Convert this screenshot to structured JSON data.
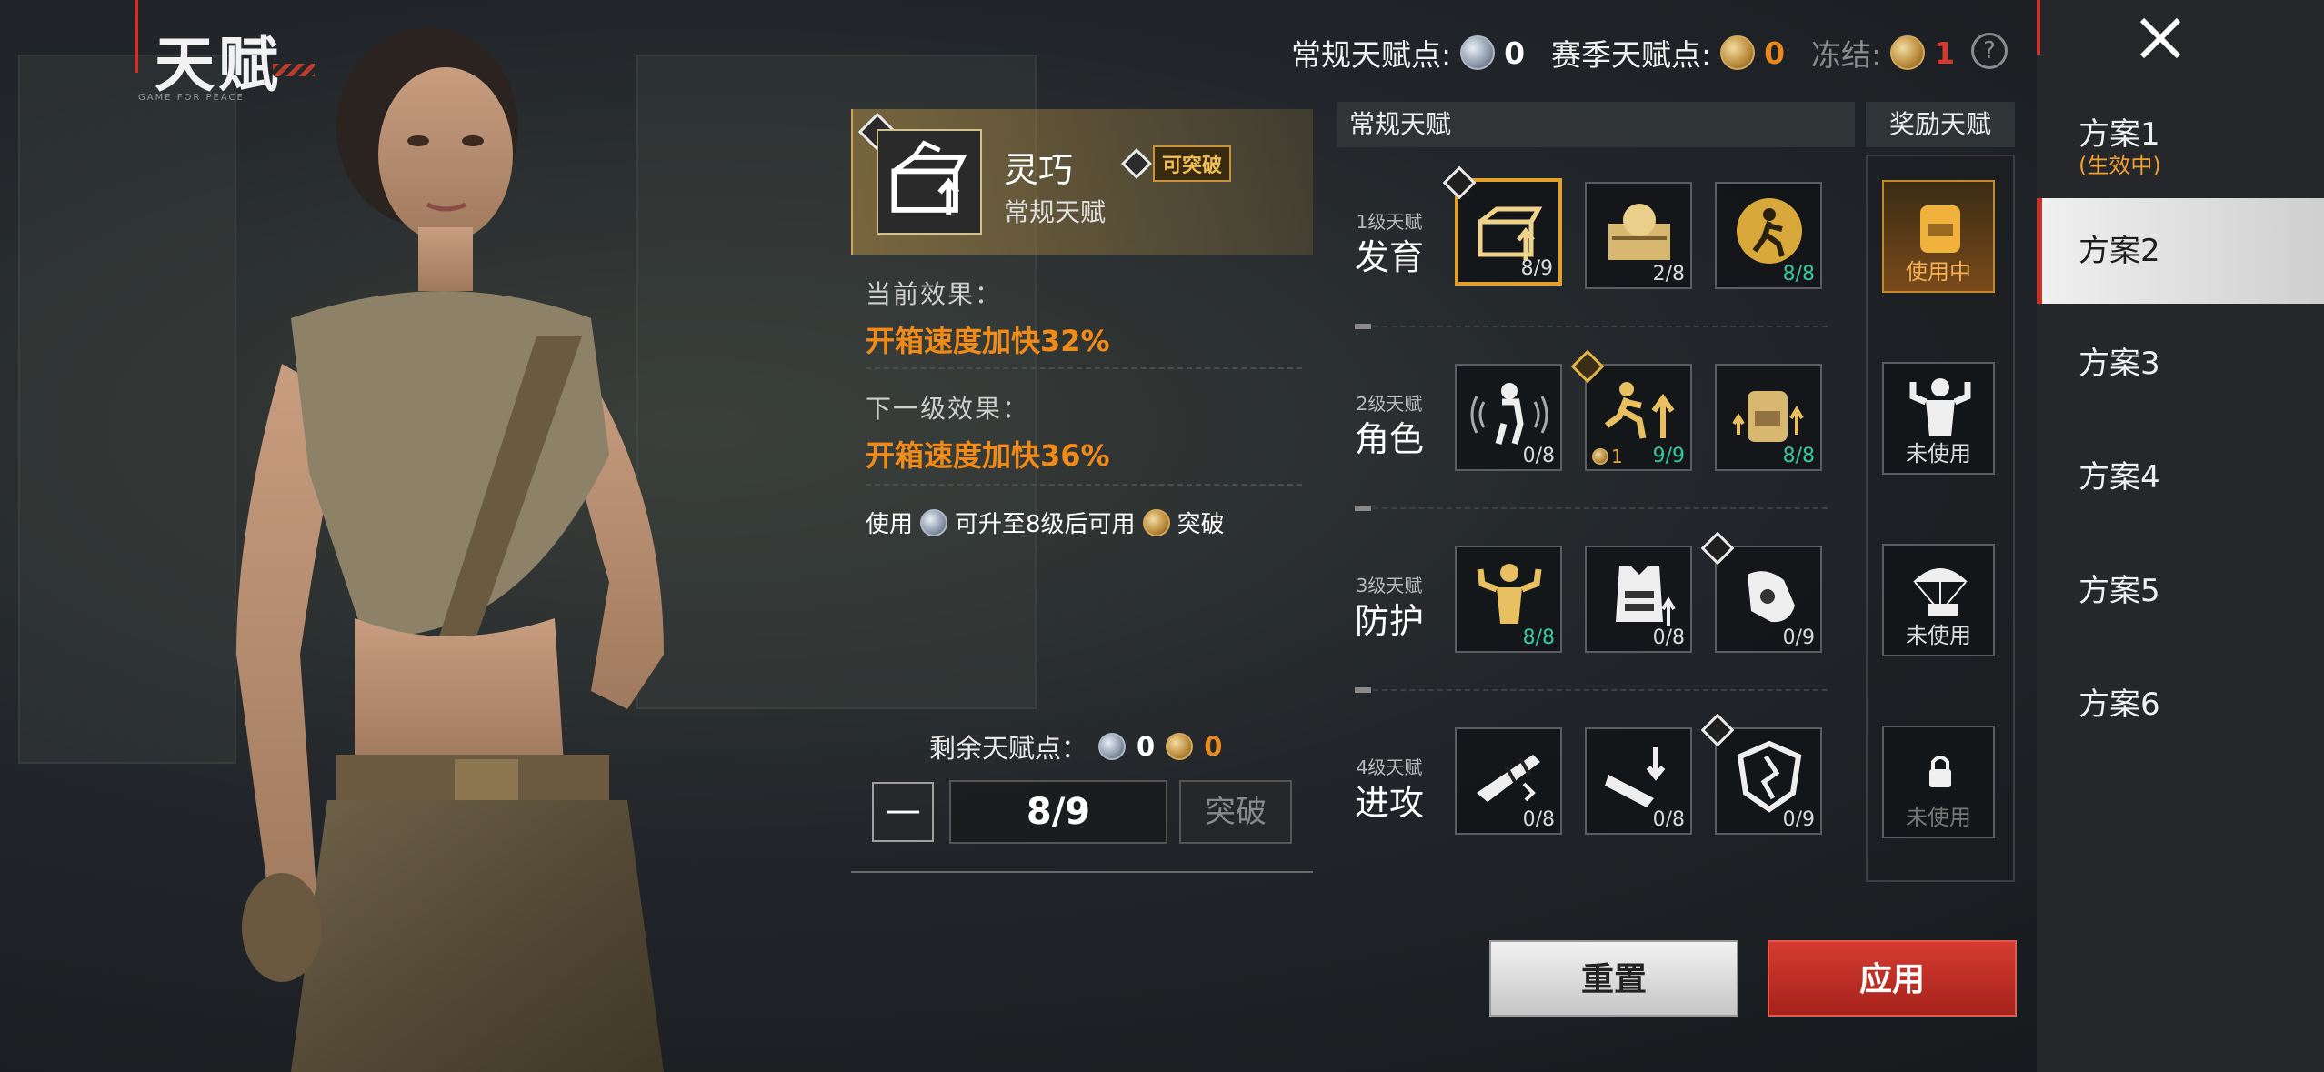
{
  "page": {
    "title": "天赋",
    "title_sub": "GAME FOR PEACE"
  },
  "currencies": {
    "regular_label": "常规天赋点:",
    "regular_value": "0",
    "season_label": "赛季天赋点:",
    "season_value": "0",
    "frozen_label": "冻结:",
    "frozen_value": "1",
    "help_icon": "question-icon"
  },
  "detail": {
    "name": "灵巧",
    "break_tag": "可突破",
    "type": "常规天赋",
    "current_label": "当前效果：",
    "current_value": "开箱速度加快32%",
    "next_label": "下一级效果：",
    "next_value": "开箱速度加快36%",
    "use_note_1": "使用",
    "use_note_2": "可升至8级后可用",
    "use_note_3": "突破",
    "remaining_label": "剩余天赋点：",
    "remaining_silver": "0",
    "remaining_gold": "0",
    "minus": "—",
    "level": "8/9",
    "break_button": "突破"
  },
  "grid": {
    "regular_header": "常规天赋",
    "reward_header": "奖励天赋",
    "rows": [
      {
        "tier": "1级天赋",
        "name": "发育",
        "cells": [
          {
            "icon": "crate-open-icon",
            "count": "8/9",
            "selected": true,
            "diamond": "white"
          },
          {
            "icon": "supply-box-icon",
            "count": "2/8"
          },
          {
            "icon": "running-medal-icon",
            "count": "8/8",
            "max": true
          }
        ]
      },
      {
        "tier": "2级天赋",
        "name": "角色",
        "cells": [
          {
            "icon": "soldier-sound-icon",
            "count": "0/8"
          },
          {
            "icon": "sprint-up-icon",
            "count": "9/9",
            "max": true,
            "extra": "1",
            "diamond": "gold"
          },
          {
            "icon": "backpack-up-icon",
            "count": "8/8",
            "max": true
          }
        ]
      },
      {
        "tier": "3级天赋",
        "name": "防护",
        "cells": [
          {
            "icon": "muscle-up-icon",
            "count": "8/8",
            "max": true
          },
          {
            "icon": "vest-up-icon",
            "count": "0/8"
          },
          {
            "icon": "glove-icon",
            "count": "0/9",
            "diamond": "white"
          }
        ]
      },
      {
        "tier": "4级天赋",
        "name": "进攻",
        "cells": [
          {
            "icon": "rifle-break-icon",
            "count": "0/8"
          },
          {
            "icon": "weapon-down-icon",
            "count": "0/8"
          },
          {
            "icon": "shield-crack-icon",
            "count": "0/9",
            "diamond": "white"
          }
        ]
      }
    ],
    "rewards": [
      {
        "icon": "backpack-gold-icon",
        "label": "使用中",
        "state": "active"
      },
      {
        "icon": "strongman-icon",
        "label": "未使用"
      },
      {
        "icon": "airdrop-icon",
        "label": "未使用"
      },
      {
        "icon": "lock-icon",
        "label": "未使用",
        "state": "locked"
      }
    ]
  },
  "buttons": {
    "reset": "重置",
    "apply": "应用"
  },
  "plans": {
    "close_icon": "close-icon",
    "items": [
      {
        "label": "方案1",
        "sub": "(生效中)"
      },
      {
        "label": "方案2",
        "selected": true
      },
      {
        "label": "方案3"
      },
      {
        "label": "方案4"
      },
      {
        "label": "方案5"
      },
      {
        "label": "方案6"
      }
    ]
  },
  "colors": {
    "accent_red": "#c8342c",
    "orange": "#f08a19",
    "gold": "#e0b44a",
    "max_green": "#38c79a"
  }
}
